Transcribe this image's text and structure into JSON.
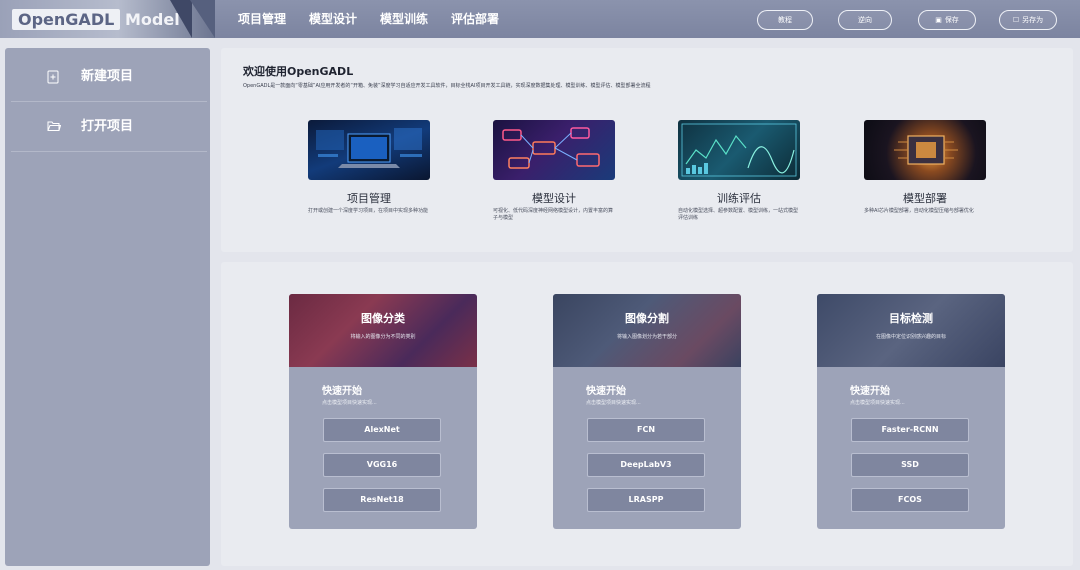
{
  "header": {
    "logo_primary": "OpenGADL",
    "logo_secondary": "Model",
    "nav": [
      "项目管理",
      "模型设计",
      "模型训练",
      "评估部署"
    ],
    "buttons": [
      {
        "label": "教程",
        "icon": "book-icon"
      },
      {
        "label": "逆向",
        "icon": "undo-icon"
      },
      {
        "label": "保存",
        "icon": "save-icon"
      },
      {
        "label": "另存为",
        "icon": "save-as-icon"
      }
    ]
  },
  "sidebar": {
    "items": [
      {
        "label": "新建项目",
        "icon": "new-file-icon"
      },
      {
        "label": "打开项目",
        "icon": "open-folder-icon"
      }
    ]
  },
  "welcome": {
    "title": "欢迎使用OpenGADL",
    "description": "OpenGADL是一款面向“零基础”AI应用开发者的“开箱、免装”深度学习自适应开发工具软件，目标全栈AI项目开发工具链，实现深度数据集处理、模型训练、模型评估、模型部署全流程",
    "features": [
      {
        "title": "项目管理",
        "desc": "打开或创建一个深度学习项目，在项目中实现多种功能",
        "thumb": "laptop-thumbnail"
      },
      {
        "title": "模型设计",
        "desc": "可视化、低代码深度神经网络模型设计，内置丰富的算子与模型",
        "thumb": "network-thumbnail"
      },
      {
        "title": "训练评估",
        "desc": "自动化模型选择、超参数配置、模型训练，一站式模型评估训练",
        "thumb": "dashboard-thumbnail"
      },
      {
        "title": "模型部署",
        "desc": "多种AI芯片模型部署，自动化模型压缩与部署优化",
        "thumb": "chip-thumbnail"
      }
    ]
  },
  "templates": {
    "cards": [
      {
        "title": "图像分类",
        "subtitle": "将输入的图像分为不同的类别",
        "quick_start": "快速开始",
        "quick_desc": "点击模型项目快速实现...",
        "models": [
          "AlexNet",
          "VGG16",
          "ResNet18"
        ]
      },
      {
        "title": "图像分割",
        "subtitle": "将输入图像划分为若干部分",
        "quick_start": "快速开始",
        "quick_desc": "点击模型项目快速实现...",
        "models": [
          "FCN",
          "DeepLabV3",
          "LRASPP"
        ]
      },
      {
        "title": "目标检测",
        "subtitle": "在图像中定位识别感兴趣的目标",
        "quick_start": "快速开始",
        "quick_desc": "点击模型项目快速实现...",
        "models": [
          "Faster-RCNN",
          "SSD",
          "FCOS"
        ]
      }
    ]
  }
}
